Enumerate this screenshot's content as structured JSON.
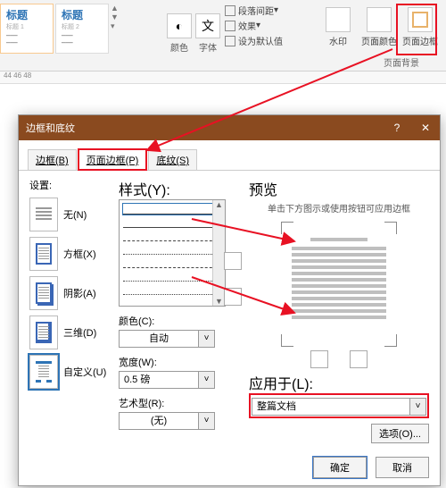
{
  "ribbon": {
    "style1": "标题",
    "style2": "标题",
    "style1_sample": "标题 1",
    "style2_sample": "标题 2",
    "color_label": "颜色",
    "font_label": "字体",
    "font_char": "文",
    "para_spacing": "段落间距",
    "effects": "效果",
    "set_default": "设为默认值",
    "watermark": "水印",
    "page_color": "页面颜色",
    "page_border": "页面边框",
    "group_label": "页面背景",
    "ruler": "44 46 48"
  },
  "dialog": {
    "title": "边框和底纹",
    "tab_border": "边框(B)",
    "tab_page_border": "页面边框(P)",
    "tab_shading": "底纹(S)",
    "settings_label": "设置:",
    "none": "无(N)",
    "box": "方框(X)",
    "shadow": "阴影(A)",
    "three_d": "三维(D)",
    "custom": "自定义(U)",
    "style_label": "样式(Y):",
    "color_label": "颜色(C):",
    "color_value": "自动",
    "width_label": "宽度(W):",
    "width_value": "0.5 磅",
    "art_label": "艺术型(R):",
    "art_value": "(无)",
    "preview_label": "预览",
    "preview_hint": "单击下方图示或使用按钮可应用边框",
    "apply_label": "应用于(L):",
    "apply_value": "整篇文档",
    "options": "选项(O)...",
    "ok": "确定",
    "cancel": "取消"
  }
}
